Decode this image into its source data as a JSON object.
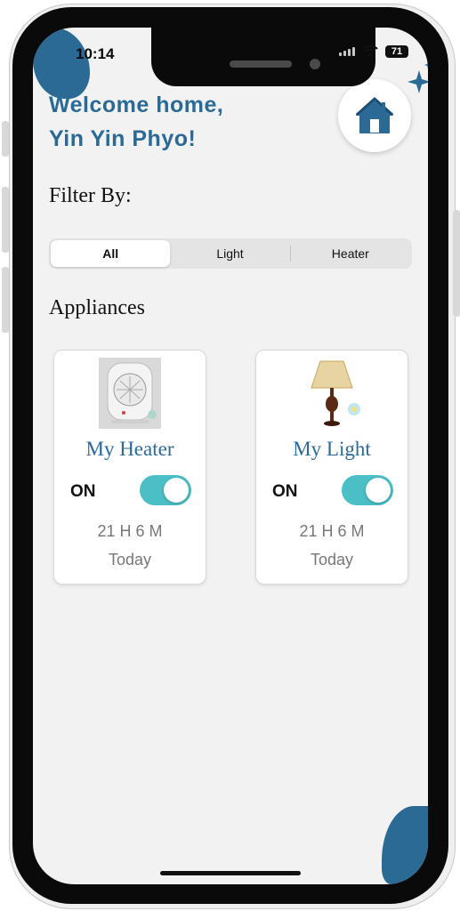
{
  "status_bar": {
    "time": "10:14",
    "battery": "71"
  },
  "header": {
    "welcome_line1": "Welcome home,",
    "welcome_line2": "Yin Yin Phyo!"
  },
  "filter": {
    "title": "Filter By:",
    "options": [
      {
        "label": "All",
        "selected": true
      },
      {
        "label": "Light",
        "selected": false
      },
      {
        "label": "Heater",
        "selected": false
      }
    ]
  },
  "appliances": {
    "title": "Appliances",
    "items": [
      {
        "name": "My Heater",
        "status": "ON",
        "is_on": true,
        "duration": "21 H 6 M",
        "date": "Today",
        "icon": "heater-image"
      },
      {
        "name": "My Light",
        "status": "ON",
        "is_on": true,
        "duration": "21 H 6 M",
        "date": "Today",
        "icon": "lamp-image"
      }
    ]
  },
  "colors": {
    "brand": "#2c6a96",
    "toggle_on": "#4bbfc6",
    "background": "#f2f2f2"
  }
}
